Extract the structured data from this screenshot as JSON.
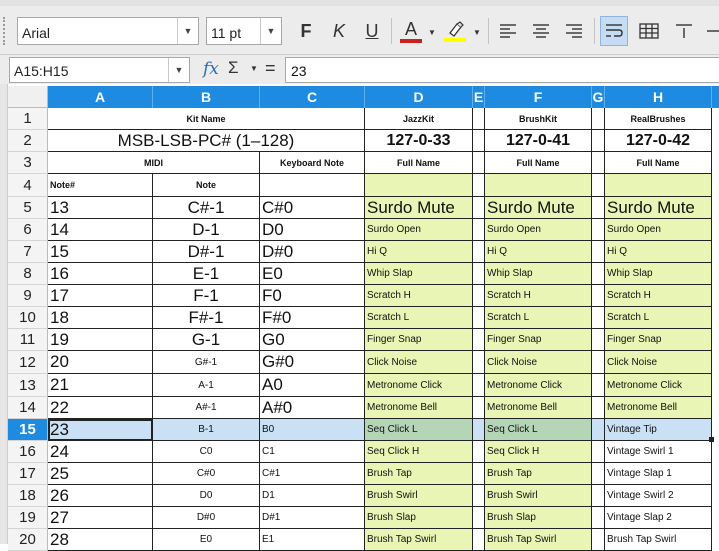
{
  "toolbar": {
    "font_name": "Arial",
    "font_size": "11 pt",
    "bold_label": "F",
    "italic_label": "K",
    "underline_label": "U",
    "font_color_label": "A",
    "colors": {
      "font_color": "#c9211e",
      "highlight": "#ffff00",
      "header": "#1e8be1",
      "kit_fill": "#e8f5b4"
    }
  },
  "formula_bar": {
    "name_box": "A15:H15",
    "fx_label": "fx",
    "sum_label": "Σ",
    "equals_label": "=",
    "content": "23"
  },
  "columns": [
    "A",
    "B",
    "C",
    "D",
    "E",
    "F",
    "G",
    "H"
  ],
  "rows": [
    {
      "num": "1",
      "note_num": "",
      "note": "",
      "kb": "",
      "d": "",
      "f": "",
      "h": ""
    },
    {
      "num": "2",
      "note_num": "",
      "note": "",
      "kb": "",
      "d": "",
      "f": "",
      "h": ""
    },
    {
      "num": "3",
      "note_num": "",
      "note": "",
      "kb": "",
      "d": "",
      "f": "",
      "h": ""
    },
    {
      "num": "4",
      "note_num": "Note#",
      "note": "Note",
      "kb": "",
      "d": "",
      "f": "",
      "h": ""
    },
    {
      "num": "5",
      "note_num": "13",
      "note": "C#-1",
      "kb": "C#0",
      "d": "Surdo Mute",
      "f": "Surdo Mute",
      "h": "Surdo Mute"
    },
    {
      "num": "6",
      "note_num": "14",
      "note": "D-1",
      "kb": "D0",
      "d": "Surdo Open",
      "f": "Surdo Open",
      "h": "Surdo Open"
    },
    {
      "num": "7",
      "note_num": "15",
      "note": "D#-1",
      "kb": "D#0",
      "d": "Hi Q",
      "f": "Hi Q",
      "h": "Hi Q"
    },
    {
      "num": "8",
      "note_num": "16",
      "note": "E-1",
      "kb": "E0",
      "d": "Whip Slap",
      "f": "Whip Slap",
      "h": "Whip Slap"
    },
    {
      "num": "9",
      "note_num": "17",
      "note": "F-1",
      "kb": "F0",
      "d": "Scratch H",
      "f": "Scratch H",
      "h": "Scratch H"
    },
    {
      "num": "10",
      "note_num": "18",
      "note": "F#-1",
      "kb": "F#0",
      "d": "Scratch L",
      "f": "Scratch L",
      "h": "Scratch L"
    },
    {
      "num": "11",
      "note_num": "19",
      "note": "G-1",
      "kb": "G0",
      "d": "Finger Snap",
      "f": "Finger Snap",
      "h": "Finger Snap"
    },
    {
      "num": "12",
      "note_num": "20",
      "note": "G#-1",
      "kb": "G#0",
      "d": "Click Noise",
      "f": "Click Noise",
      "h": "Click Noise"
    },
    {
      "num": "13",
      "note_num": "21",
      "note": "A-1",
      "kb": "A0",
      "d": "Metronome Click",
      "f": "Metronome Click",
      "h": "Metronome Click"
    },
    {
      "num": "14",
      "note_num": "22",
      "note": "A#-1",
      "kb": "A#0",
      "d": "Metronome Bell",
      "f": "Metronome Bell",
      "h": "Metronome Bell"
    },
    {
      "num": "15",
      "note_num": "23",
      "note": "B-1",
      "kb": "B0",
      "d": "Seq Click L",
      "f": "Seq Click L",
      "h": "Vintage Tip"
    },
    {
      "num": "16",
      "note_num": "24",
      "note": "C0",
      "kb": "C1",
      "d": "Seq Click H",
      "f": "Seq Click H",
      "h": "Vintage Swirl 1"
    },
    {
      "num": "17",
      "note_num": "25",
      "note": "C#0",
      "kb": "C#1",
      "d": "Brush Tap",
      "f": "Brush Tap",
      "h": "Vintage Slap 1"
    },
    {
      "num": "18",
      "note_num": "26",
      "note": "D0",
      "kb": "D1",
      "d": "Brush Swirl",
      "f": "Brush Swirl",
      "h": "Vintage Swirl 2"
    },
    {
      "num": "19",
      "note_num": "27",
      "note": "D#0",
      "kb": "D#1",
      "d": "Brush Slap",
      "f": "Brush Slap",
      "h": "Vintage Slap 2"
    },
    {
      "num": "20",
      "note_num": "28",
      "note": "E0",
      "kb": "E1",
      "d": "Brush Tap Swirl",
      "f": "Brush Tap Swirl",
      "h": "Brush Tap Swirl"
    }
  ],
  "sheet": {
    "kit_name": "Kit Name",
    "jazzkit": "JazzKit",
    "brushkit": "BrushKit",
    "realbrushes": "RealBrushes",
    "msb_label": "MSB-LSB-PC# (1–128)",
    "jazz_pc": "127-0-33",
    "brush_pc": "127-0-41",
    "real_pc": "127-0-42",
    "midi": "MIDI",
    "keyboard_note": "Keyboard Note",
    "full_name": "Full Name"
  }
}
